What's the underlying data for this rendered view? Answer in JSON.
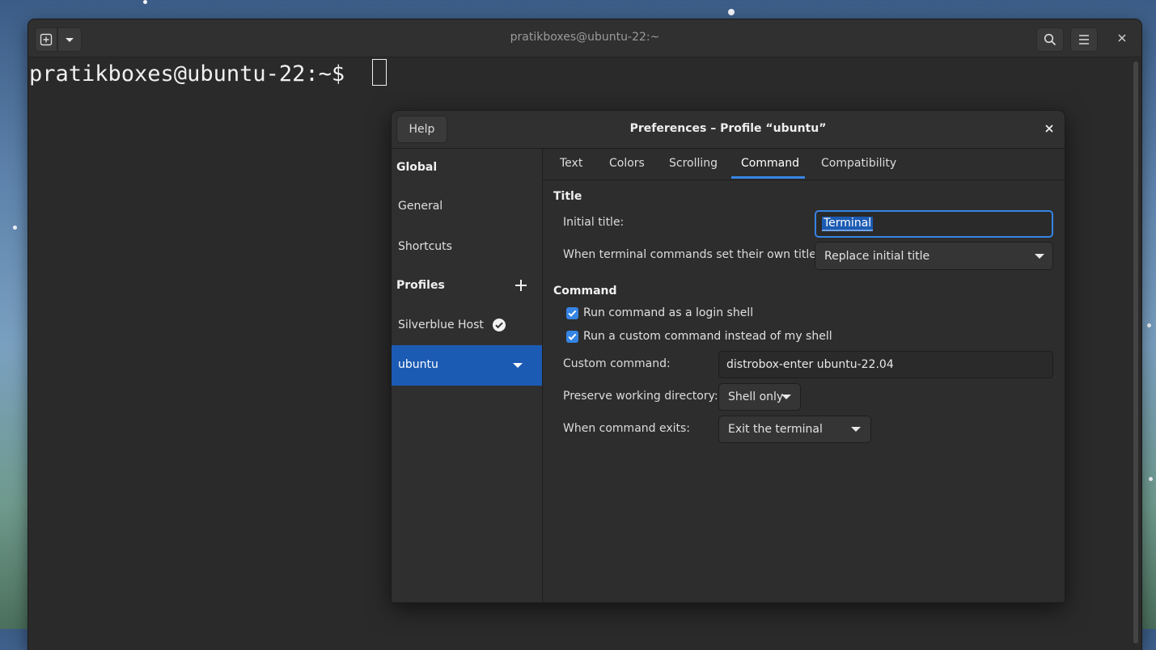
{
  "window": {
    "title": "pratikboxes@ubuntu-22:~",
    "prompt": "pratikboxes@ubuntu-22:~$"
  },
  "dialog": {
    "title": "Preferences – Profile “ubuntu”",
    "help_label": "Help"
  },
  "sidebar": {
    "global_heading": "Global",
    "general": "General",
    "shortcuts": "Shortcuts",
    "profiles_heading": "Profiles",
    "profile_1": "Silverblue Host",
    "profile_2": "ubuntu"
  },
  "tabs": [
    "Text",
    "Colors",
    "Scrolling",
    "Command",
    "Compatibility"
  ],
  "active_tab": "Command",
  "title_section": {
    "heading": "Title",
    "initial_title_label": "Initial title:",
    "initial_title_value": "Terminal",
    "own_titles_label": "When terminal commands set their own titles:",
    "own_titles_value": "Replace initial title"
  },
  "command_section": {
    "heading": "Command",
    "login_shell_label": "Run command as a login shell",
    "login_shell_checked": true,
    "custom_cmd_toggle_label": "Run a custom command instead of my shell",
    "custom_cmd_toggle_checked": true,
    "custom_command_label": "Custom command:",
    "custom_command_value": "distrobox-enter ubuntu-22.04",
    "preserve_dir_label": "Preserve working directory:",
    "preserve_dir_value": "Shell only",
    "on_exit_label": "When command exits:",
    "on_exit_value": "Exit the terminal"
  },
  "colors": {
    "accent": "#3584e4",
    "selection": "#1c5bb3",
    "window_bg": "#2b2b2b"
  }
}
